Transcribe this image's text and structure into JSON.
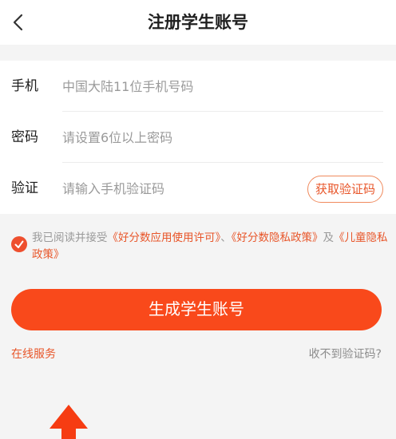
{
  "header": {
    "title": "注册学生账号",
    "back_icon": "chevron-left-icon"
  },
  "form": {
    "phone": {
      "label": "手机",
      "placeholder": "中国大陆11位手机号码",
      "value": ""
    },
    "password": {
      "label": "密码",
      "placeholder": "请设置6位以上密码",
      "value": ""
    },
    "verify": {
      "label": "验证",
      "placeholder": "请输入手机验证码",
      "value": "",
      "get_code_label": "获取验证码"
    }
  },
  "agreement": {
    "checked": true,
    "prefix": "我已阅读并接受",
    "link1": "《好分数应用使用许可》",
    "sep1": "、",
    "link2": "《好分数隐私政策》",
    "sep2": "及",
    "link3": "《儿童隐私政策》"
  },
  "submit_label": "生成学生账号",
  "footer": {
    "online_service": "在线服务",
    "no_code": "收不到验证码?"
  },
  "colors": {
    "accent": "#f9491b",
    "link": "#e8562a",
    "background": "#f4f4f4"
  }
}
